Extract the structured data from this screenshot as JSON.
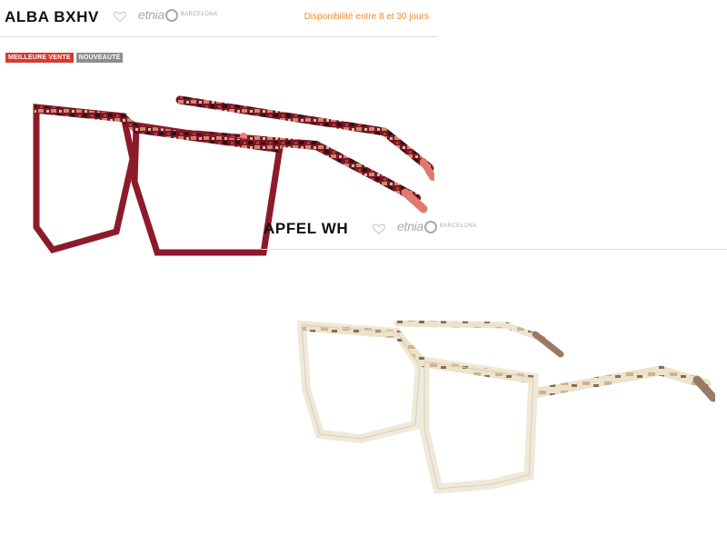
{
  "products": [
    {
      "name": "ALBA BXHV",
      "brand": {
        "word": "etnia",
        "city": "BARCELONA"
      },
      "availability": "Disponibilité entre 8 et 30 jours",
      "badges": {
        "best": "MEILLEURE VENTE",
        "new": "NOUVEAUTÉ"
      },
      "frame_color": "#8c1a2b",
      "icons": {
        "favorite": "heart-outline-icon",
        "brand": "etnia-logo-icon"
      }
    },
    {
      "name": "APFEL WH",
      "brand": {
        "word": "etnia",
        "city": "BARCELONA"
      },
      "frame_color": "#efe9d9",
      "icons": {
        "favorite": "heart-outline-icon",
        "brand": "etnia-logo-icon"
      }
    }
  ],
  "colors": {
    "availability": "#ee8a2d",
    "badge_best": "#d63b2f",
    "badge_new": "#8e8e8e"
  }
}
